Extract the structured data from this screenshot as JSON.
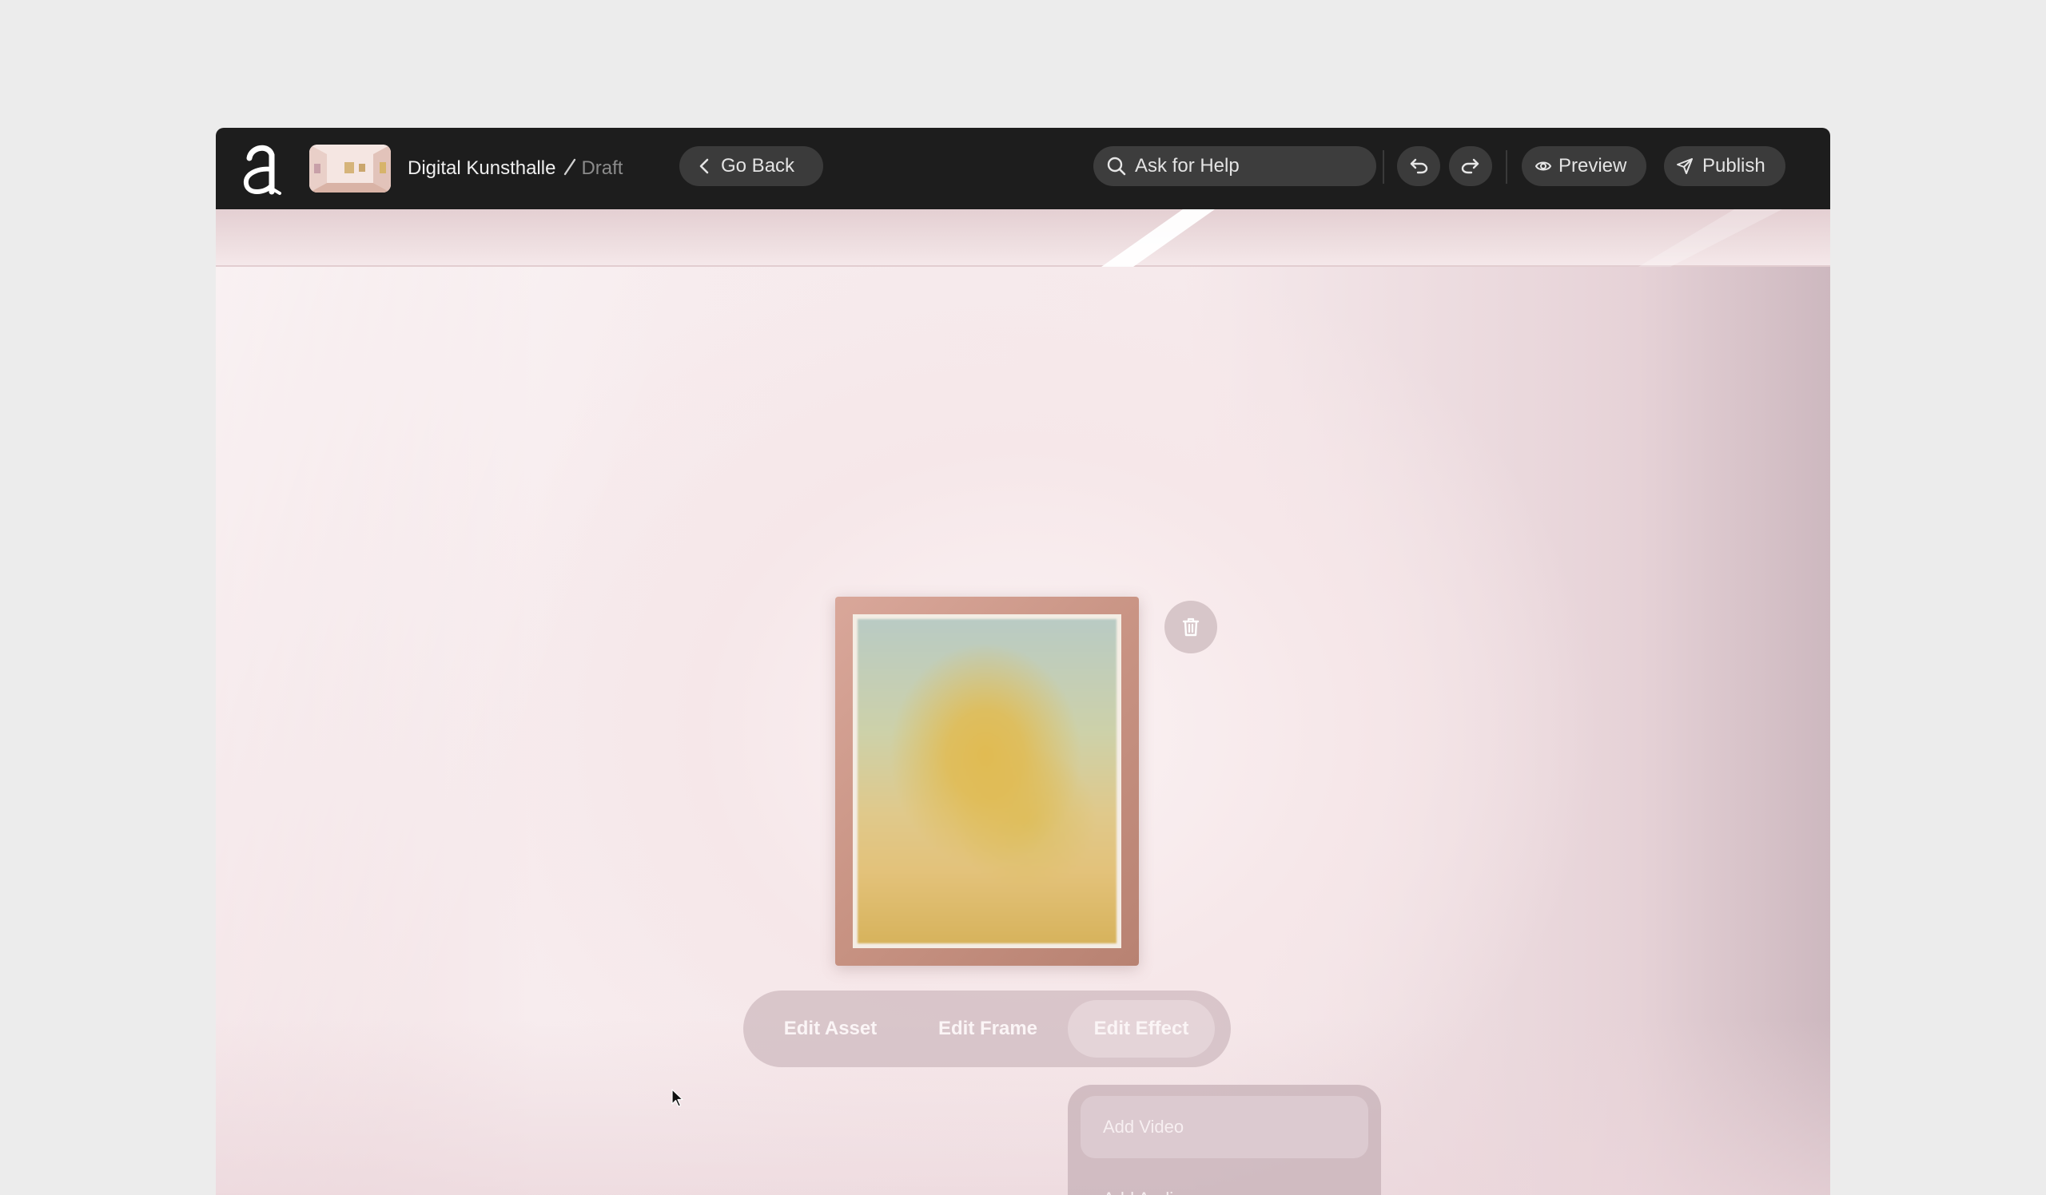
{
  "app": {
    "project_name": "Digital Kunsthalle",
    "status": "Draft"
  },
  "toolbar": {
    "go_back_label": "Go Back",
    "help_placeholder": "Ask for Help",
    "preview_label": "Preview",
    "publish_label": "Publish"
  },
  "artwork_toolbar": {
    "tabs": [
      "Edit Asset",
      "Edit Frame",
      "Edit Effect"
    ],
    "active_tab": "Edit Effect"
  },
  "effect_menu": {
    "items": [
      "Add Video",
      "Add Audio"
    ],
    "highlighted": "Add Video"
  },
  "colors": {
    "topbar": "#1d1d1d",
    "pill": "#3b3b3b",
    "wall": "#f6e9eb",
    "frame_wood": "#c89383"
  },
  "icons": {
    "logo": "a-logo-icon",
    "back": "chevron-left-icon",
    "search": "search-icon",
    "undo": "undo-icon",
    "redo": "redo-icon",
    "preview": "eye-icon",
    "publish": "send-icon",
    "delete": "trash-icon"
  }
}
